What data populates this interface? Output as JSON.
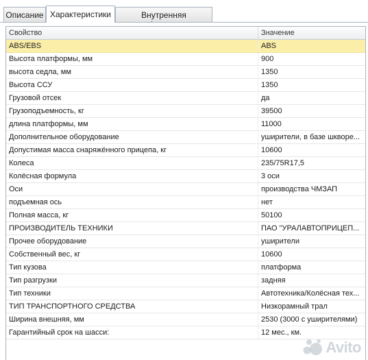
{
  "tabs": [
    {
      "label": "Описание",
      "active": false
    },
    {
      "label": "Характеристики",
      "active": true
    },
    {
      "label": "Внутренняя информация",
      "active": false
    }
  ],
  "table": {
    "columns": [
      "Свойство",
      "Значение"
    ],
    "selected_row": 0,
    "rows": [
      {
        "name": "ABS/EBS",
        "value": "ABS"
      },
      {
        "name": "Высота платформы, мм",
        "value": "900"
      },
      {
        "name": "высота седла, мм",
        "value": "1350"
      },
      {
        "name": "Высота ССУ",
        "value": "1350"
      },
      {
        "name": "Грузовой отсек",
        "value": "да"
      },
      {
        "name": "Грузоподъемность, кг",
        "value": "39500"
      },
      {
        "name": "длина платформы, мм",
        "value": "11000"
      },
      {
        "name": "Дополнительное оборудование",
        "value": "уширители, в базе шкворе..."
      },
      {
        "name": "Допустимая масса снаряжённого прицепа, кг",
        "value": "10600"
      },
      {
        "name": "Колеса",
        "value": "235/75R17,5"
      },
      {
        "name": "Колёсная формула",
        "value": "3 оси"
      },
      {
        "name": "Оси",
        "value": "производства ЧМЗАП"
      },
      {
        "name": "подъемная ось",
        "value": "нет"
      },
      {
        "name": "Полная масса, кг",
        "value": "50100"
      },
      {
        "name": "ПРОИЗВОДИТЕЛЬ ТЕХНИКИ",
        "value": "ПАО \"УРАЛАВТОПРИЦЕП..."
      },
      {
        "name": "Прочее оборудование",
        "value": "уширители"
      },
      {
        "name": "Собственный вес, кг",
        "value": "10600"
      },
      {
        "name": "Тип кузова",
        "value": "платформа"
      },
      {
        "name": "Тип разгрузки",
        "value": "задняя"
      },
      {
        "name": "Тип техники",
        "value": "Автотехника/Колёсная тех..."
      },
      {
        "name": "ТИП ТРАНСПОРТНОГО СРЕДСТВА",
        "value": "Низкорамный трал"
      },
      {
        "name": "Ширина внешняя, мм",
        "value": "2530 (3000 с уширителями)"
      },
      {
        "name": "Гарантийный срок на шасси:",
        "value": "12 мес.,  км."
      }
    ]
  },
  "watermark": {
    "text": "Avito",
    "icon": "avito-logo-icon"
  },
  "colors": {
    "selected_row": "#fbeea8",
    "border": "#a9b3bf"
  }
}
